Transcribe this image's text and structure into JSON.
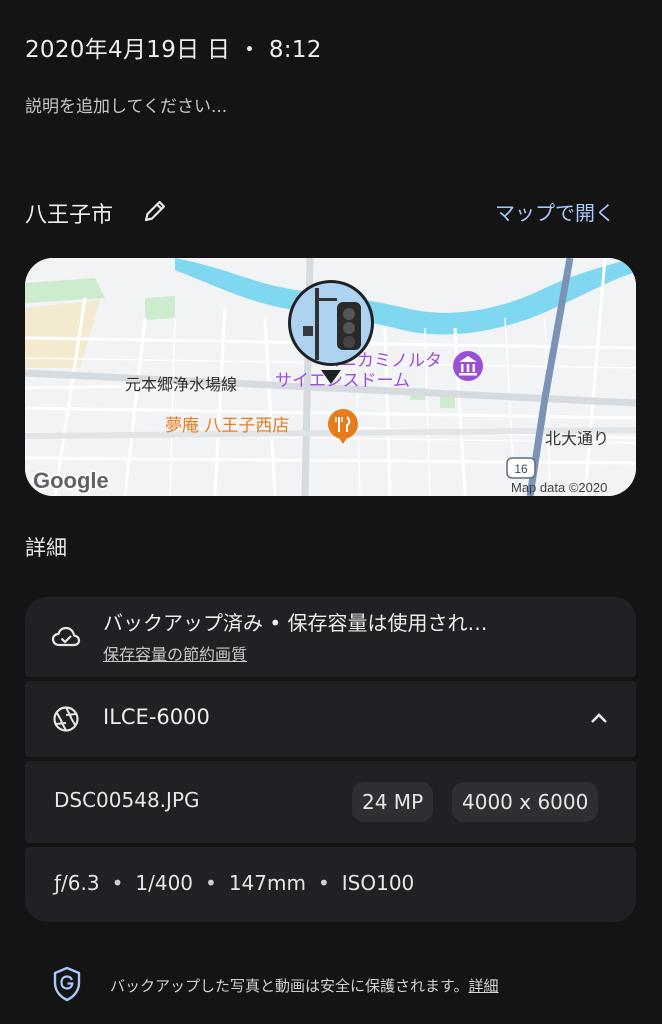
{
  "header": {
    "date": "2020年4月19日 日 ・ 8:12",
    "description_placeholder": "説明を追加してください..."
  },
  "location": {
    "name": "八王子市",
    "open_map_label": "マップで開く"
  },
  "map": {
    "labels": {
      "museum_line1": "コニカミノルタ",
      "museum_line2": "サイエンスドーム",
      "restaurant": "夢庵 八王子西店",
      "facility": "元本郷浄水場線",
      "street": "北大通り",
      "route": "16",
      "google_logo": "Google",
      "attribution": "Map data ©2020"
    }
  },
  "details": {
    "section_title": "詳細",
    "backup": {
      "title": "バックアップ済み • 保存容量は使用され…",
      "link": "保存容量の節約画質"
    },
    "camera": {
      "model": "ILCE-6000"
    },
    "file": {
      "name": "DSC00548.JPG",
      "megapixels": "24 MP",
      "resolution": "4000 x 6000"
    },
    "exif": {
      "aperture": "ƒ/6.3",
      "shutter": "1/400",
      "focal_length": "147mm",
      "iso": "ISO100"
    }
  },
  "footer": {
    "text": "バックアップした写真と動画は安全に保護されます。",
    "link": "詳細"
  },
  "colors": {
    "background": "#141414",
    "card": "#202124",
    "link": "#a8c7fa",
    "river": "#80d8f0",
    "museum_purple": "#9a4fd9",
    "restaurant_orange": "#e67c1e",
    "highway_blue": "#7b93b5"
  },
  "icons": {
    "edit": "pencil-icon",
    "backup": "cloud-done-icon",
    "camera": "aperture-icon",
    "collapse": "chevron-up-icon",
    "security": "shield-g-icon"
  }
}
